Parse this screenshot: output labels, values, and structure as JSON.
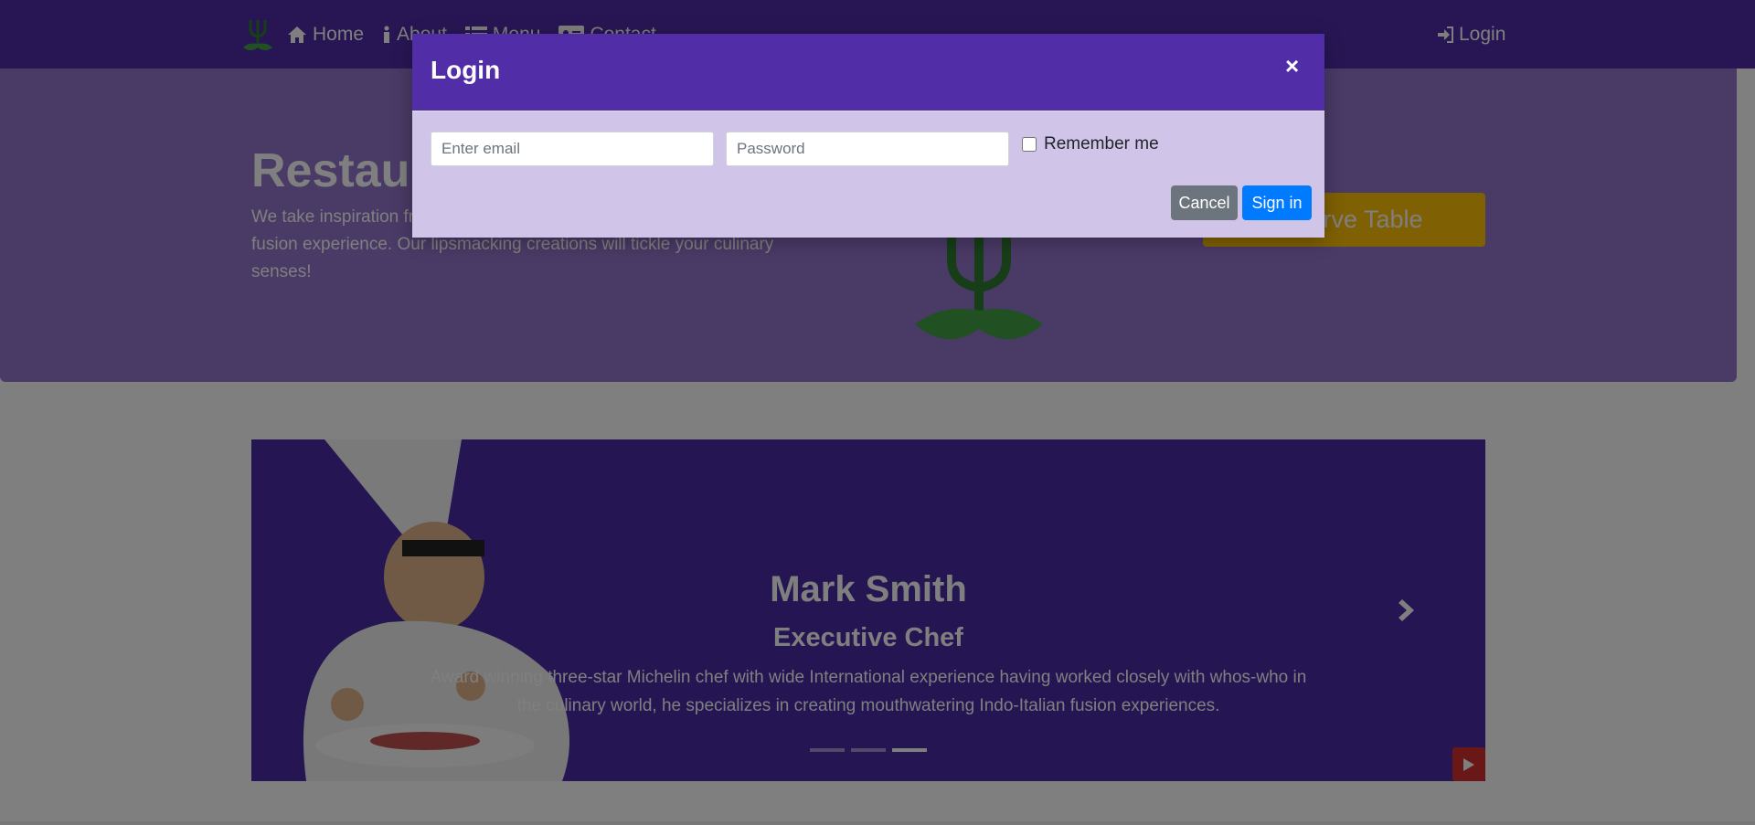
{
  "navbar": {
    "logo_icon": "fork-leaf-logo",
    "links": [
      {
        "label": "Home",
        "icon": "home-icon"
      },
      {
        "label": "About",
        "icon": "info-icon"
      },
      {
        "label": "Menu",
        "icon": "list-icon"
      },
      {
        "label": "Contact",
        "icon": "address-card-icon"
      }
    ],
    "login": {
      "label": "Login",
      "icon": "sign-in-icon"
    }
  },
  "jumbotron": {
    "title": "Restaurant Con Fusion",
    "text": "We take inspiration from the World's best cuisines, and create a unique fusion experience. Our lipsmacking creations will tickle your culinary senses!",
    "reserve_label": "Reserve Table"
  },
  "carousel": {
    "name": "Mark Smith",
    "role": "Executive Chef",
    "description": "Award winning three-star Michelin chef with wide International experience having worked closely with whos-who in the culinary world, he specializes in creating mouthwatering Indo-Italian fusion experiences.",
    "slides": 3,
    "active_slide": 3
  },
  "modal": {
    "title": "Login",
    "close": "×",
    "email_placeholder": "Enter email",
    "password_placeholder": "Password",
    "remember_label": "Remember me",
    "cancel_label": "Cancel",
    "signin_label": "Sign in"
  },
  "colors": {
    "primary": "#512da8",
    "primary_light": "#9575cd",
    "modal_body": "#d1c4e9",
    "reserve": "#ffc107",
    "signin": "#007bff",
    "cancel": "#6c757d",
    "play": "#d32f2f"
  }
}
